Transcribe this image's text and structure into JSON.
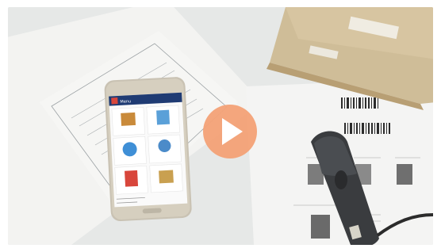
{
  "video": {
    "state": "paused",
    "play_label": "Play video"
  },
  "phone": {
    "app_title": "Menu",
    "tiles": [
      {
        "icon": "boxes-icon",
        "color": "#c98a3a"
      },
      {
        "icon": "clipboard-icon",
        "color": "#5aa0d8"
      },
      {
        "icon": "globe-icon",
        "color": "#3f8fd6"
      },
      {
        "icon": "person-icon",
        "color": "#4b8bc9"
      },
      {
        "icon": "document-icon",
        "color": "#d8463b"
      },
      {
        "icon": "cart-icon",
        "color": "#c9a050"
      }
    ]
  },
  "colors": {
    "play_button": "#f4a278",
    "phone_body": "#c9c2b3",
    "scanner": "#3a3c3f",
    "app_bar": "#1f3b73"
  }
}
